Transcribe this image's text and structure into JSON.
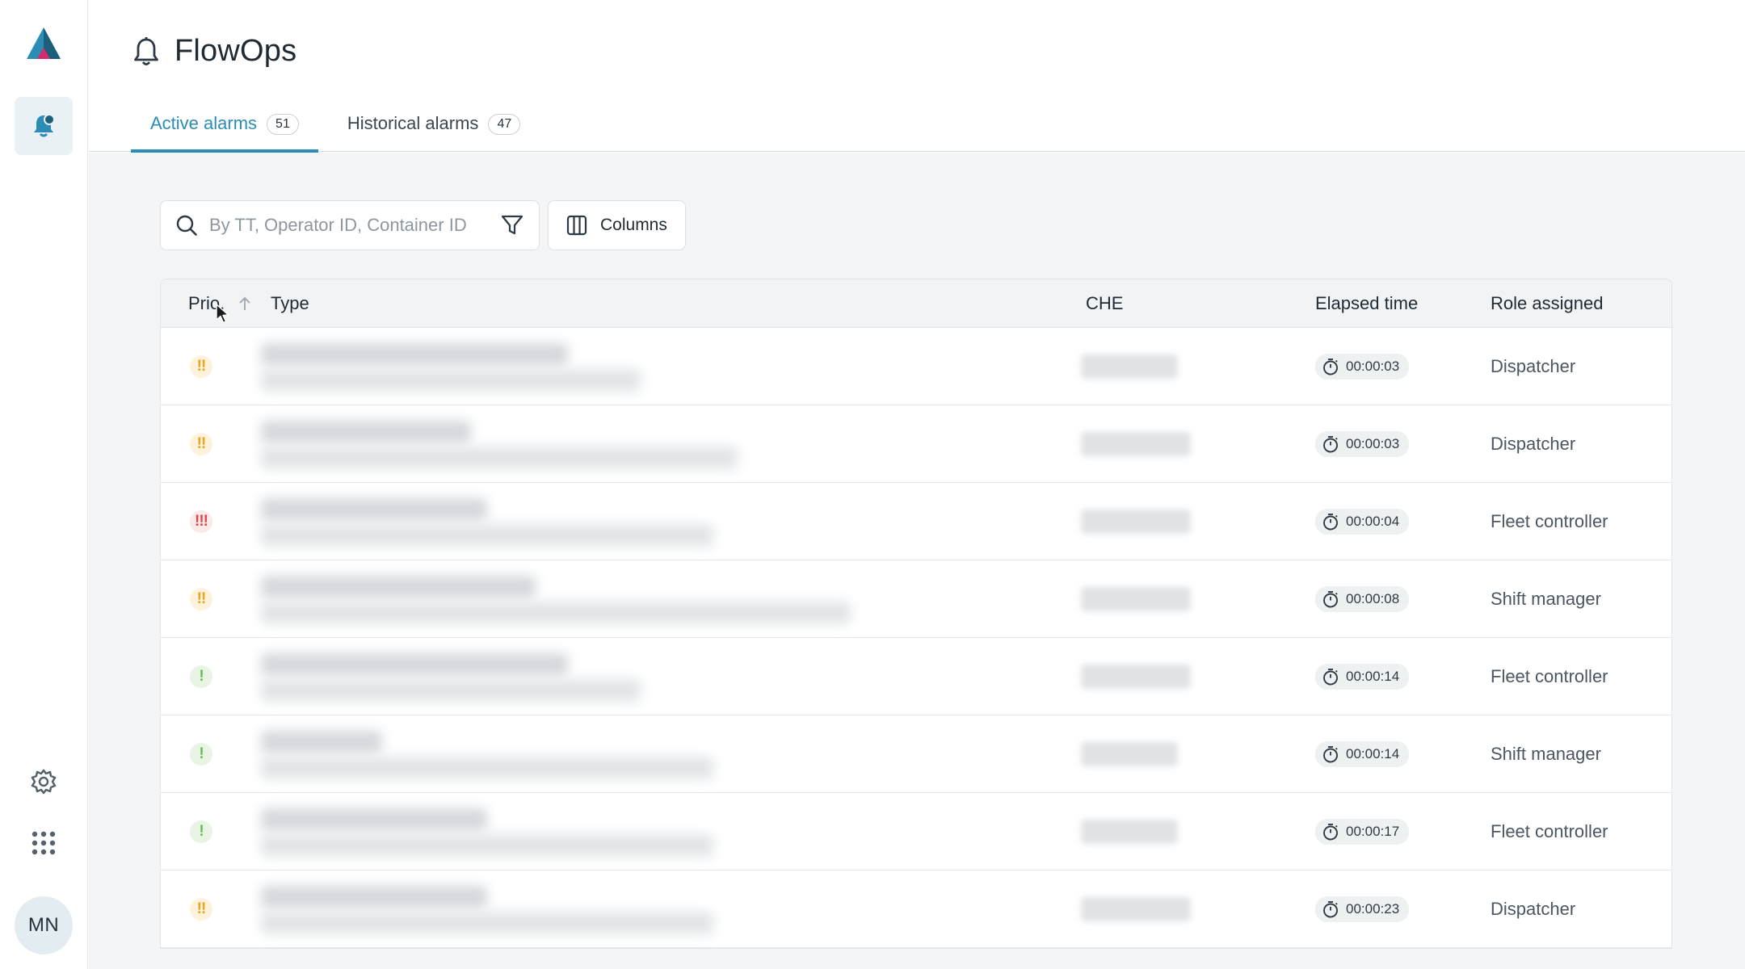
{
  "app": {
    "title": "FlowOps",
    "user_initials": "MN"
  },
  "tabs": [
    {
      "label": "Active alarms",
      "count": "51",
      "active": true
    },
    {
      "label": "Historical alarms",
      "count": "47",
      "active": false
    }
  ],
  "toolbar": {
    "search_placeholder": "By TT, Operator ID, Container ID",
    "columns_label": "Columns"
  },
  "table": {
    "headers": {
      "prio": "Prio.",
      "type": "Type",
      "che": "CHE",
      "elapsed": "Elapsed time",
      "role": "Role assigned"
    },
    "rows": [
      {
        "prio": "!!",
        "level": "med",
        "elapsed": "00:00:03",
        "role": "Dispatcher"
      },
      {
        "prio": "!!",
        "level": "med",
        "elapsed": "00:00:03",
        "role": "Dispatcher"
      },
      {
        "prio": "!!!",
        "level": "high",
        "elapsed": "00:00:04",
        "role": "Fleet controller"
      },
      {
        "prio": "!!",
        "level": "med",
        "elapsed": "00:00:08",
        "role": "Shift manager"
      },
      {
        "prio": "!",
        "level": "low",
        "elapsed": "00:00:14",
        "role": "Fleet controller"
      },
      {
        "prio": "!",
        "level": "low",
        "elapsed": "00:00:14",
        "role": "Shift manager"
      },
      {
        "prio": "!",
        "level": "low",
        "elapsed": "00:00:17",
        "role": "Fleet controller"
      },
      {
        "prio": "!!",
        "level": "med",
        "elapsed": "00:00:23",
        "role": "Dispatcher"
      }
    ]
  },
  "colors": {
    "accent": "#2b8db3",
    "prio_high": "#e0474c",
    "prio_med": "#f1a21c",
    "prio_low": "#6fba52"
  },
  "icons": {
    "logo": "triangle-logo-icon",
    "nav_alarms": "alarm-bell-icon",
    "settings": "gear-icon",
    "apps": "grid-icon",
    "title": "bell-icon",
    "search": "search-icon",
    "filter": "filter-icon",
    "columns": "columns-icon",
    "elapsed": "stopwatch-icon",
    "sort": "sort-up-icon"
  }
}
